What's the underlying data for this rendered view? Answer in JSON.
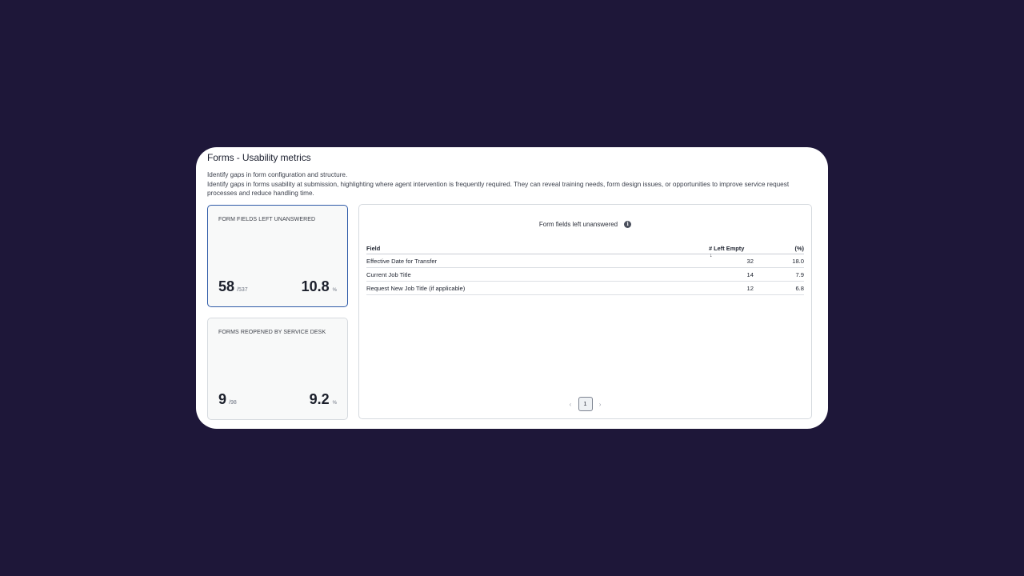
{
  "panel": {
    "title": "Forms - Usability metrics",
    "description_lines": [
      "Identify gaps in form configuration and structure.",
      "Identify gaps in forms usability at submission, highlighting where agent intervention is frequently required. They can reveal training needs, form design issues, or opportunities to improve service request processes and reduce handling time."
    ]
  },
  "cards": [
    {
      "label": "FORM FIELDS LEFT UNANSWERED",
      "count": "58",
      "total": "/537",
      "percent": "10.8",
      "percent_unit": "%",
      "selected": true
    },
    {
      "label": "FORMS REOPENED BY SERVICE DESK",
      "count": "9",
      "total": "/98",
      "percent": "9.2",
      "percent_unit": "%",
      "selected": false
    }
  ],
  "table": {
    "title": "Form fields left unanswered",
    "info_icon": "info-icon",
    "headers": {
      "field": "Field",
      "left_empty": "# Left Empty",
      "percent": "(%)"
    },
    "sort_indicator": "↓",
    "rows": [
      {
        "field": "Effective Date for Transfer",
        "left_empty": "32",
        "percent": "18.0"
      },
      {
        "field": "Current Job Title",
        "left_empty": "14",
        "percent": "7.9"
      },
      {
        "field": "Request New Job Title (if applicable)",
        "left_empty": "12",
        "percent": "6.8"
      }
    ]
  },
  "pagination": {
    "prev": "‹",
    "current": "1",
    "next": "›"
  },
  "colors": {
    "background": "#1e1739",
    "selected_border": "#2e5aa8"
  }
}
